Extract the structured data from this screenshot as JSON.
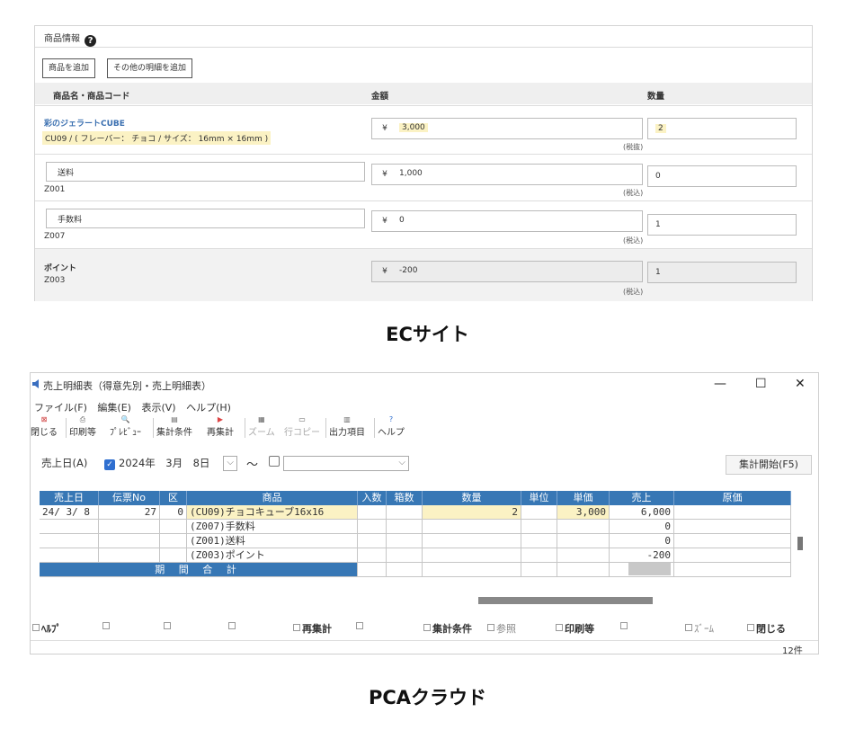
{
  "ec": {
    "header": "商品情報",
    "help_glyph": "?",
    "buttons": {
      "add_product": "商品を追加",
      "add_other": "その他の明細を追加"
    },
    "columns": {
      "name": "商品名・商品コード",
      "amount": "金額",
      "qty": "数量"
    },
    "currency": "¥",
    "rows": [
      {
        "name": "彩のジェラートCUBE",
        "code": "CU09 / ( フレーバー： チョコ / サイズ： 16mm × 16mm )",
        "amount": "3,000",
        "tax": "(税抜)",
        "qty": "2"
      },
      {
        "name": "送料",
        "code": "Z001",
        "amount": "1,000",
        "tax": "(税込)",
        "qty": "0"
      },
      {
        "name": "手数料",
        "code": "Z007",
        "amount": "0",
        "tax": "(税込)",
        "qty": "1"
      },
      {
        "name": "ポイント",
        "code": "Z003",
        "amount": "-200",
        "tax": "(税込)",
        "qty": "1"
      }
    ],
    "caption": "ECサイト"
  },
  "pca": {
    "title": "売上明細表（得意先別・売上明細表）",
    "window_controls": {
      "min": "—",
      "max": "☐",
      "close": "✕"
    },
    "menu": [
      "ファイル(F)",
      "編集(E)",
      "表示(V)",
      "ヘルプ(H)"
    ],
    "toolbar": [
      {
        "label": "閉じる",
        "icon": "close-icon",
        "glyph": "⊠"
      },
      {
        "label": "印刷等",
        "icon": "printer-icon",
        "glyph": "⎙"
      },
      {
        "label": "ﾌﾟﾚﾋﾞｭｰ",
        "icon": "preview-icon",
        "glyph": "🔍"
      },
      {
        "label": "集計条件",
        "icon": "conditions-icon",
        "glyph": "▤"
      },
      {
        "label": "再集計",
        "icon": "recalc-icon",
        "glyph": "▶"
      },
      {
        "label": "ズーム",
        "icon": "zoom-icon",
        "glyph": "▦"
      },
      {
        "label": "行コピー",
        "icon": "row-copy-icon",
        "glyph": "▭"
      },
      {
        "label": "出力項目",
        "icon": "output-items-icon",
        "glyph": "▥"
      },
      {
        "label": "ヘルプ",
        "icon": "help-icon",
        "glyph": "?"
      }
    ],
    "date_label": "売上日(A)",
    "date_check": "✓",
    "date_value": "2024年　3月　8日",
    "dropdown_glyph": "⌵",
    "tilde": "～",
    "start_button": "集計開始(F5)",
    "grid": {
      "headers": [
        "売上日",
        "伝票No",
        "区",
        "商品",
        "入数",
        "箱数",
        "数量",
        "単位",
        "単価",
        "売上",
        "原価"
      ],
      "rows": [
        [
          "24/ 3/ 8",
          "27",
          "0",
          "(CU09)チョコキューブ16x16",
          "",
          "",
          "2",
          "",
          "3,000",
          "6,000",
          ""
        ],
        [
          "",
          "",
          "",
          "(Z007)手数料",
          "",
          "",
          "",
          "",
          "",
          "0",
          ""
        ],
        [
          "",
          "",
          "",
          "(Z001)送料",
          "",
          "",
          "",
          "",
          "",
          "0",
          ""
        ],
        [
          "",
          "",
          "",
          "(Z003)ポイント",
          "",
          "",
          "",
          "",
          "",
          "-200",
          ""
        ]
      ],
      "total_label": "期 間 合 計"
    },
    "fkeys": [
      {
        "label": "ﾍﾙﾌﾟ",
        "style": "bold"
      },
      {
        "label": "",
        "style": ""
      },
      {
        "label": "",
        "style": ""
      },
      {
        "label": "",
        "style": ""
      },
      {
        "label": "再集計",
        "style": "bold"
      },
      {
        "label": "",
        "style": ""
      },
      {
        "label": "集計条件",
        "style": "bold"
      },
      {
        "label": "参照",
        "style": "dim"
      },
      {
        "label": "印刷等",
        "style": "bold"
      },
      {
        "label": "",
        "style": ""
      },
      {
        "label": "ｽﾞｰﾑ",
        "style": "dim"
      },
      {
        "label": "閉じる",
        "style": "bold"
      }
    ],
    "status_count": "12件",
    "caption": "PCAクラウド"
  }
}
